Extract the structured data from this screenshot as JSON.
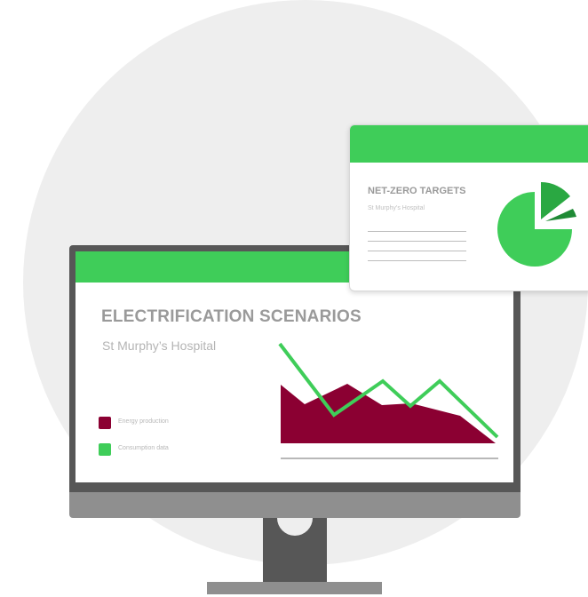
{
  "monitor": {
    "title": "ELECTRIFICATION SCENARIOS",
    "subtitle": "St Murphy’s Hospital",
    "legend": [
      {
        "label": "Energy production",
        "color": "#8b0032"
      },
      {
        "label": "Consumption data",
        "color": "#3fcd59"
      }
    ]
  },
  "card": {
    "title": "NET-ZERO TARGETS",
    "subtitle": "St Murphy’s Hospital"
  },
  "colors": {
    "brand_green": "#3fcd59",
    "dark_green": "#2aa842",
    "deep_green": "#1f8a35",
    "maroon": "#8b0032",
    "frame_dark": "#575757",
    "frame_light": "#8f8f8f",
    "background_circle": "#eeeeee"
  }
}
